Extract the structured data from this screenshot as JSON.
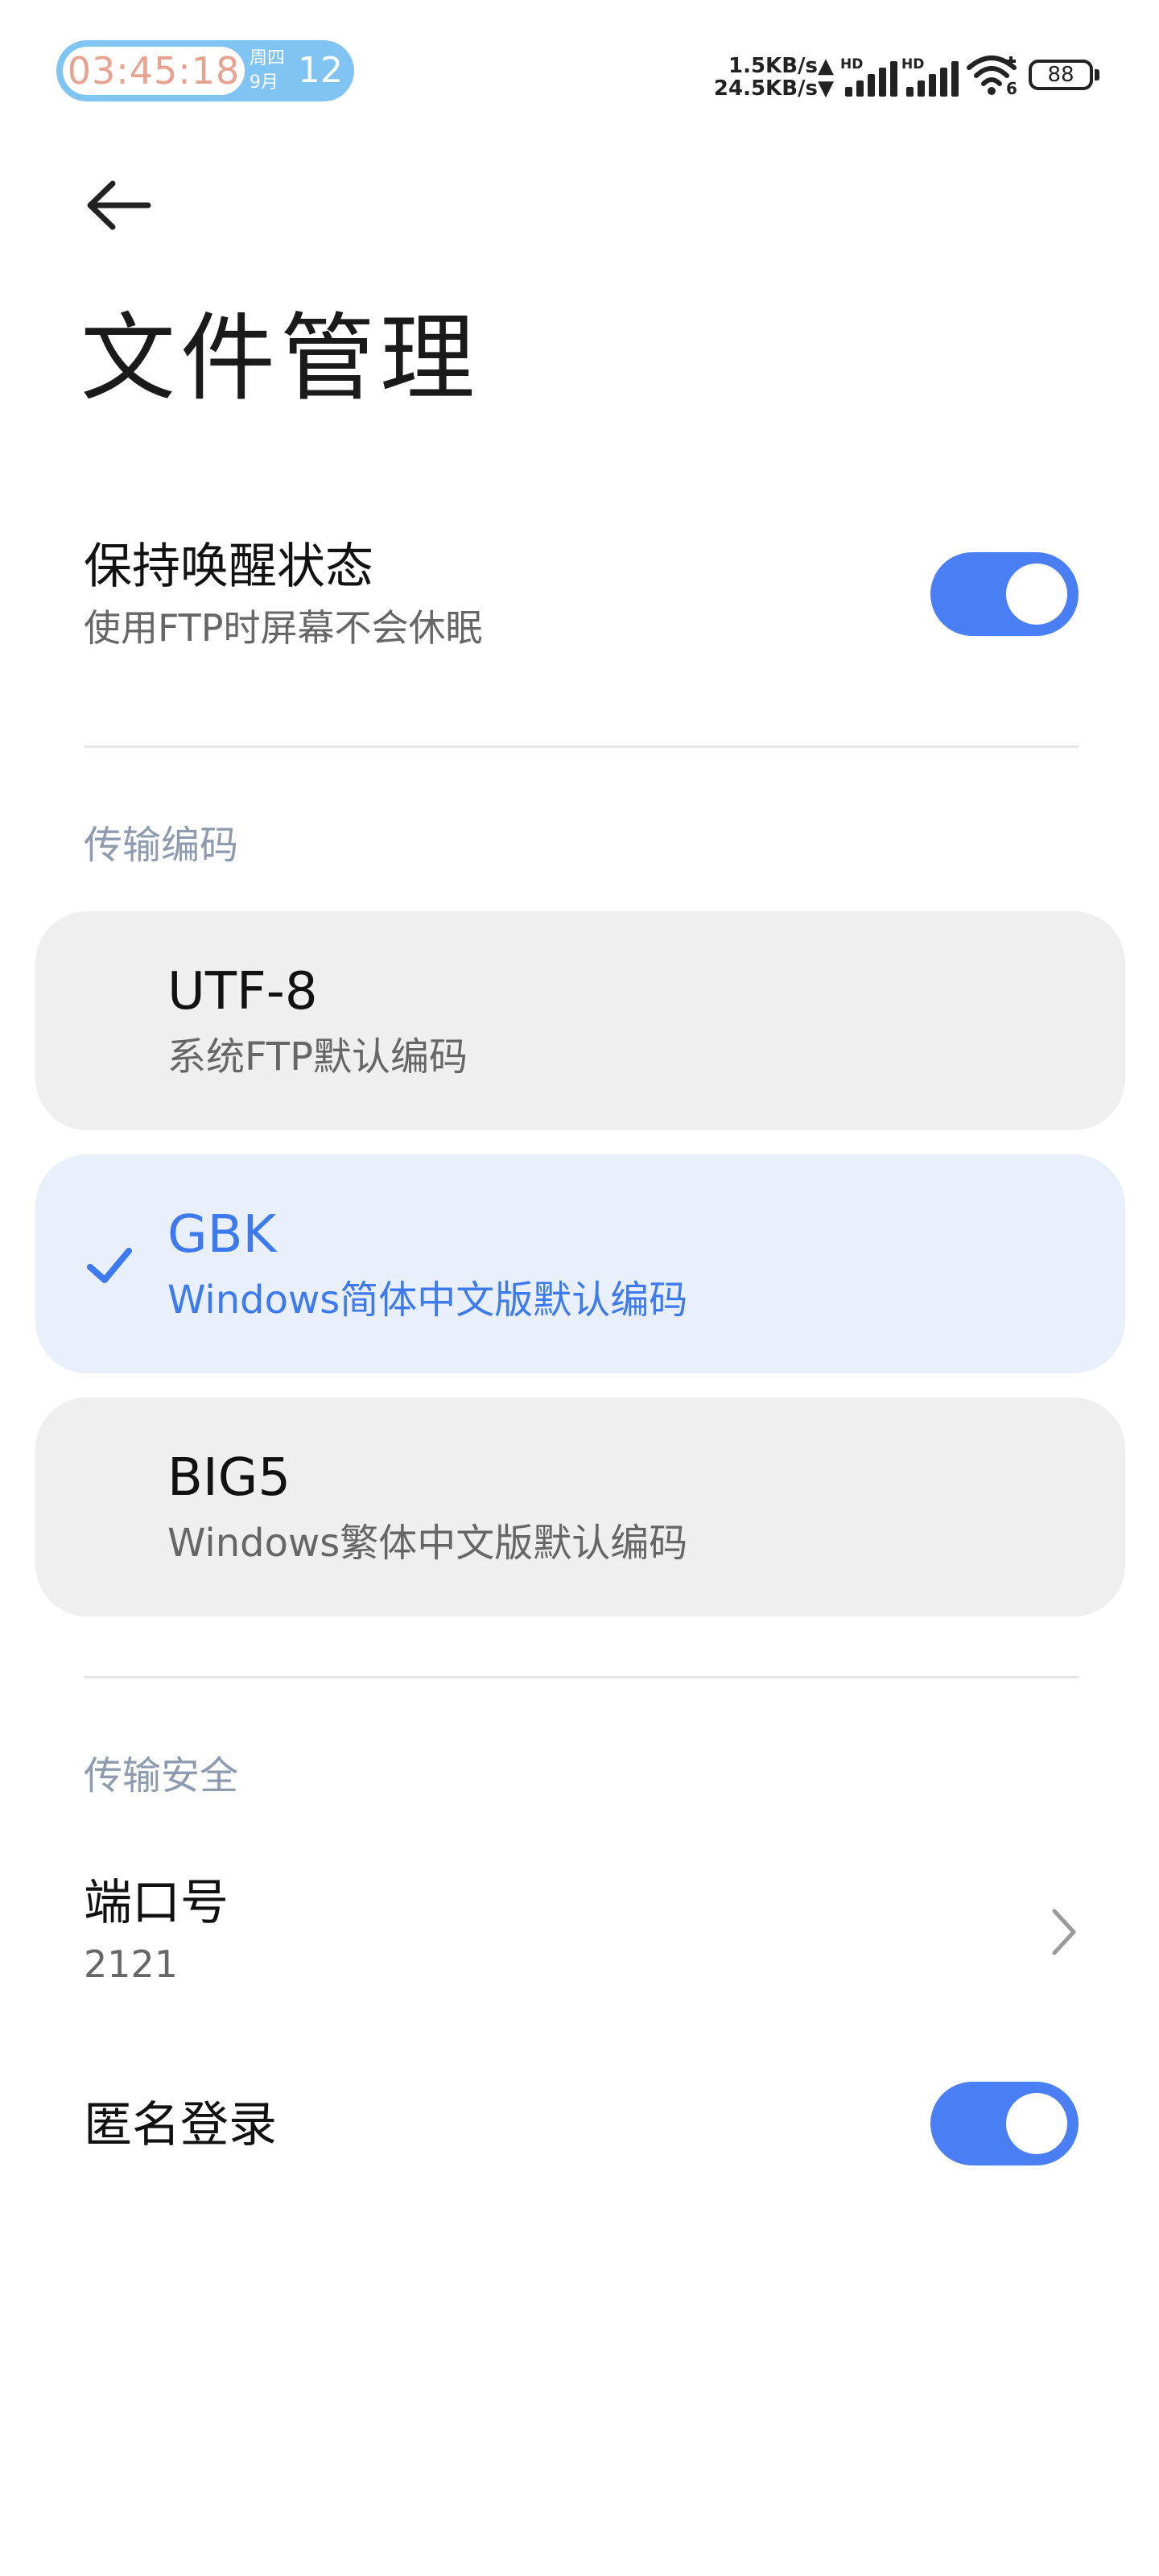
{
  "status_bar": {
    "time": "03:45:18",
    "weekday": "周四",
    "month": "9月",
    "day": "12",
    "upload_speed": "1.5KB/s▲",
    "download_speed": "24.5KB/s▼",
    "signal1_label": "HD",
    "signal2_label": "HD",
    "wifi_label": "6",
    "battery": "88"
  },
  "header": {
    "title": "文件管理"
  },
  "keep_awake": {
    "title": "保持唤醒状态",
    "subtitle": "使用FTP时屏幕不会休眠",
    "enabled": true
  },
  "encoding": {
    "header": "传输编码",
    "options": [
      {
        "title": "UTF-8",
        "subtitle": "系统FTP默认编码",
        "selected": false
      },
      {
        "title": "GBK",
        "subtitle": "Windows简体中文版默认编码",
        "selected": true
      },
      {
        "title": "BIG5",
        "subtitle": "Windows繁体中文版默认编码",
        "selected": false
      }
    ]
  },
  "security": {
    "header": "传输安全",
    "port_title": "端口号",
    "port_value": "2121",
    "anonymous_title": "匿名登录",
    "anonymous_enabled": true
  },
  "colors": {
    "accent": "#4a7ef5",
    "selected_text": "#3d7af0",
    "selected_bg": "#e9f0fc",
    "card_bg": "#efefef",
    "section_header": "#8d9ab0",
    "time_pill": "#7fc4f2",
    "time_text": "#e8a28f"
  },
  "icons": {
    "back": "arrow-left-icon",
    "check": "check-icon",
    "chevron": "chevron-right-icon",
    "wifi": "wifi-icon",
    "battery": "battery-icon",
    "signal": "signal-icon"
  }
}
